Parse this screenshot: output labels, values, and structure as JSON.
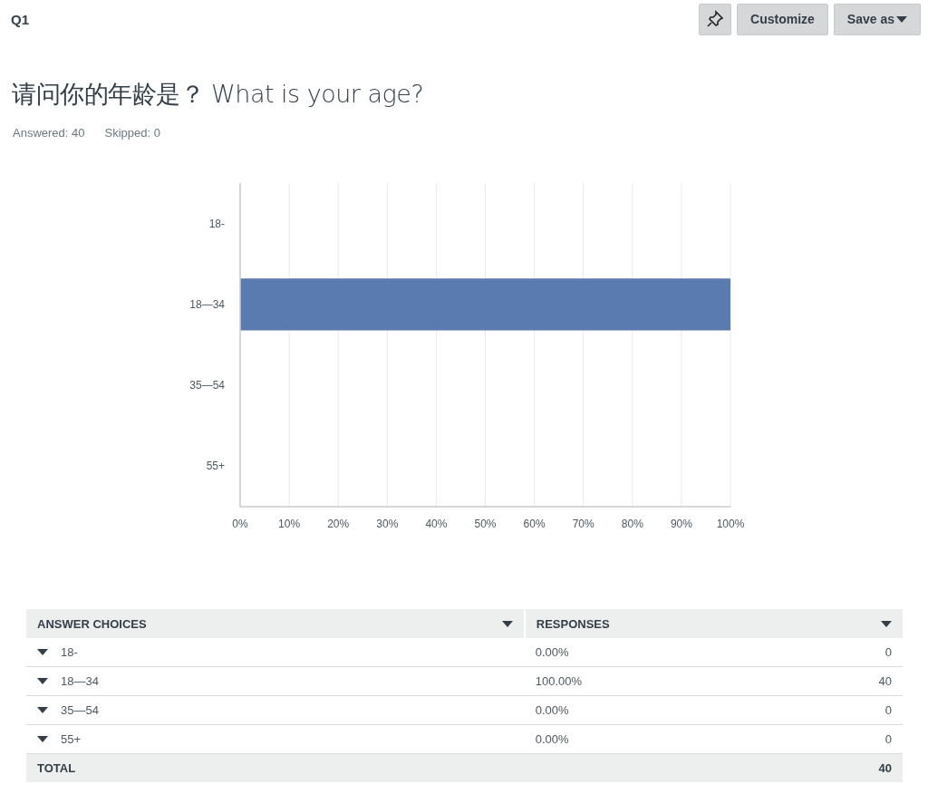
{
  "header": {
    "question_number": "Q1",
    "buttons": [
      {
        "kind": "pin"
      },
      {
        "kind": "text",
        "label": "Customize"
      },
      {
        "kind": "dropdown",
        "label": "Save as"
      }
    ]
  },
  "question": {
    "title": "请问你的年龄是？ What is your age?",
    "answered": "Answered: 40",
    "skipped": "Skipped: 0"
  },
  "chart_data": {
    "type": "bar",
    "orientation": "horizontal",
    "categories": [
      "18-",
      "18—34",
      "35—54",
      "55+"
    ],
    "series": [
      {
        "color": "#5a7bb0",
        "values": [
          0,
          100,
          0,
          0
        ]
      }
    ],
    "grid": true,
    "xlim": [
      0,
      100
    ],
    "xticks": [
      {
        "value": 0,
        "label": "0%"
      },
      {
        "value": 10,
        "label": "10%"
      },
      {
        "value": 20,
        "label": "20%"
      },
      {
        "value": 30,
        "label": "30%"
      },
      {
        "value": 40,
        "label": "40%"
      },
      {
        "value": 50,
        "label": "50%"
      },
      {
        "value": 60,
        "label": "60%"
      },
      {
        "value": 70,
        "label": "70%"
      },
      {
        "value": 80,
        "label": "80%"
      },
      {
        "value": 90,
        "label": "90%"
      },
      {
        "value": 100,
        "label": "100%"
      }
    ]
  },
  "table": {
    "columns": [
      "ANSWER CHOICES",
      "RESPONSES"
    ],
    "rows": [
      {
        "choice": "18-",
        "percent": "0.00%",
        "count": "0"
      },
      {
        "choice": "18—34",
        "percent": "100.00%",
        "count": "40"
      },
      {
        "choice": "35—54",
        "percent": "0.00%",
        "count": "0"
      },
      {
        "choice": "55+",
        "percent": "0.00%",
        "count": "0"
      }
    ],
    "total": {
      "label": "TOTAL",
      "count": "40"
    }
  }
}
